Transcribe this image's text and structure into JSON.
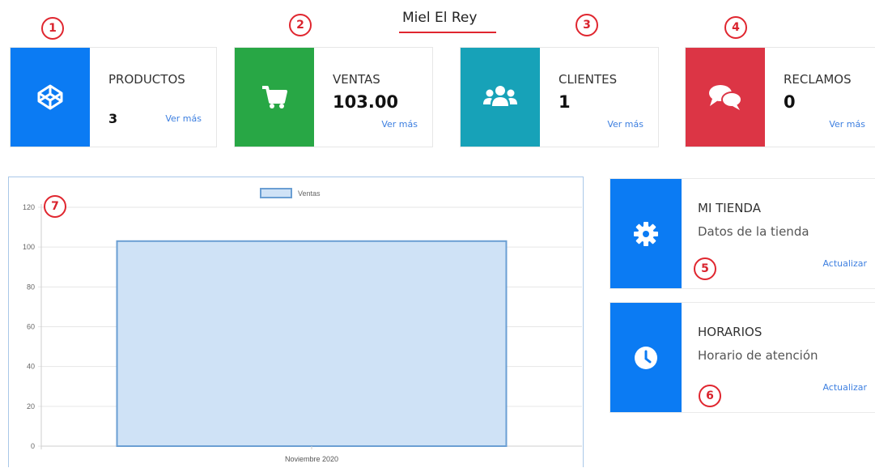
{
  "header": {
    "title": "Miel El Rey"
  },
  "badges": [
    "1",
    "2",
    "3",
    "4",
    "5",
    "6",
    "7"
  ],
  "cards": [
    {
      "label": "PRODUCTOS",
      "value": "3",
      "link": "Ver más",
      "icon": "codepen-cube-icon",
      "color": "#0b7bf3"
    },
    {
      "label": "VENTAS",
      "value": "103.00",
      "link": "Ver más",
      "icon": "shopping-cart-icon",
      "color": "#28a745"
    },
    {
      "label": "CLIENTES",
      "value": "1",
      "link": "Ver más",
      "icon": "users-icon",
      "color": "#17a2b8"
    },
    {
      "label": "RECLAMOS",
      "value": "0",
      "link": "Ver más",
      "icon": "comments-icon",
      "color": "#dc3545"
    }
  ],
  "side_cards": [
    {
      "title": "MI TIENDA",
      "subtitle": "Datos de la tienda",
      "link": "Actualizar",
      "icon": "gear-icon"
    },
    {
      "title": "HORARIOS",
      "subtitle": "Horario de atención",
      "link": "Actualizar",
      "icon": "clock-icon"
    }
  ],
  "chart_data": {
    "type": "bar",
    "categories": [
      "Noviembre 2020"
    ],
    "series": [
      {
        "name": "Ventas",
        "values": [
          103
        ]
      }
    ],
    "ylim": [
      0,
      120
    ],
    "yticks": [
      "0",
      "20",
      "40",
      "60",
      "80",
      "100",
      "120"
    ],
    "legend": "top-center",
    "grid": true,
    "bar_fill": "#cfe2f6",
    "bar_stroke": "#6b9fd3"
  }
}
